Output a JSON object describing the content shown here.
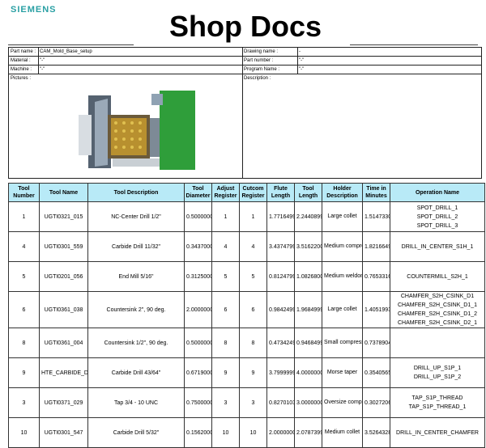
{
  "brand": "SIEMENS",
  "title": "Shop Docs",
  "header": {
    "part_name_label": "Part name :",
    "part_name_value": "CAM_Mold_Base_setup",
    "material_label": "Material :",
    "material_value": "\"-\"",
    "machine_label": "Machine :",
    "machine_value": "\"-\"",
    "pictures_label": "Pictures :",
    "drawing_name_label": "Drawing name :",
    "drawing_name_value": "-",
    "part_number_label": "Part number :",
    "part_number_value": "\"-\"",
    "program_name_label": "Program Name :",
    "program_name_value": "\"-\"",
    "description_label": "Description :"
  },
  "table": {
    "headers": [
      "Tool Number",
      "Tool Name",
      "Tool Description",
      "Tool Diameter",
      "Adjust Register",
      "Cutcom Register",
      "Flute Length",
      "Tool Length",
      "Holder Description",
      "Time in Minutes",
      "Operation Name"
    ],
    "rows": [
      {
        "num": "1",
        "name": "UGTI0321_015",
        "desc": "NC-Center Drill 1/2\"",
        "dia": "0.5000000",
        "adj": "1",
        "cut": "1",
        "flute": "1.7716499",
        "len": "2.2440899",
        "holder": "Large collet",
        "time": "1.5147330",
        "ops": [
          "SPOT_DRILL_1",
          "SPOT_DRILL_2",
          "SPOT_DRILL_3"
        ]
      },
      {
        "num": "4",
        "name": "UGTI0301_559",
        "desc": "Carbide Drill 11/32\"",
        "dia": "0.3437000",
        "adj": "4",
        "cut": "4",
        "flute": "3.4374799",
        "len": "3.5162200",
        "holder": "Medium compression",
        "time": "1.8216649",
        "ops": [
          "DRILL_IN_CENTER_S1H_1"
        ]
      },
      {
        "num": "5",
        "name": "UGTI0201_056",
        "desc": "End Mill 5/16\"",
        "dia": "0.3125000",
        "adj": "5",
        "cut": "5",
        "flute": "0.8124799",
        "len": "1.0826800",
        "holder": "Medium weldon",
        "time": "0.7653316",
        "ops": [
          "COUNTERMILL_S2H_1"
        ]
      },
      {
        "num": "6",
        "name": "UGTI0361_038",
        "desc": "Countersink 2\", 90 deg.",
        "dia": "2.0000000",
        "adj": "6",
        "cut": "6",
        "flute": "0.9842499",
        "len": "1.9684999",
        "holder": "Large collet",
        "time": "1.4051993",
        "ops": [
          "CHAMFER_S2H_CSINK_D1",
          "CHAMFER_S2H_CSINK_D1_1",
          "CHAMFER_S2H_CSINK_D1_2",
          "CHAMFER_S2H_CSINK_D2_1"
        ]
      },
      {
        "num": "8",
        "name": "UGTI0361_004",
        "desc": "Countersink 1/2\", 90 deg.",
        "dia": "0.5000000",
        "adj": "8",
        "cut": "8",
        "flute": "0.4734249",
        "len": "0.9468499",
        "holder": "Small compression",
        "time": "0.7378904",
        "ops": []
      },
      {
        "num": "9",
        "name": "HTE_CARBIDE_DR",
        "desc": "Carbide Drill 43/64\"",
        "dia": "0.6719000",
        "adj": "9",
        "cut": "9",
        "flute": "3.7999999",
        "len": "4.0000000",
        "holder": "Morse taper",
        "time": "0.3540565",
        "ops": [
          "DRILL_UP_S1P_1",
          "DRILL_UP_S1P_2"
        ]
      },
      {
        "num": "3",
        "name": "UGTI0371_029",
        "desc": "Tap 3/4 - 10 UNC",
        "dia": "0.7500000",
        "adj": "3",
        "cut": "3",
        "flute": "0.8270103",
        "len": "3.0000000",
        "holder": "Oversize compression",
        "time": "0.3027206",
        "ops": [
          "TAP_S1P_THREAD",
          "TAP_S1P_THREAD_1"
        ]
      },
      {
        "num": "10",
        "name": "UGTI0301_547",
        "desc": "Carbide Drill 5/32\"",
        "dia": "0.1562000",
        "adj": "10",
        "cut": "10",
        "flute": "2.0000000",
        "len": "2.0787399",
        "holder": "Medium collet",
        "time": "3.5264328",
        "ops": [
          "DRILL_IN_CENTER_CHAMFER"
        ]
      }
    ]
  },
  "colors": {
    "brand": "#2aa0a4",
    "header_bg": "#b8eaf7",
    "part_green": "#2f9e3a"
  }
}
